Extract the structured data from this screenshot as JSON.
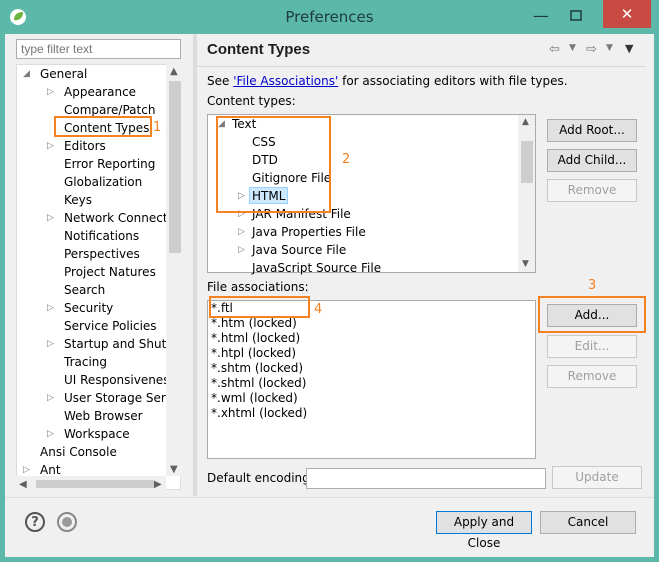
{
  "window": {
    "title": "Preferences",
    "minimize": "—",
    "close": "✕"
  },
  "filter": {
    "placeholder": "type filter text"
  },
  "tree": {
    "items": [
      {
        "label": "General",
        "twisty": "◢",
        "level": 0
      },
      {
        "label": "Appearance",
        "twisty": "▷",
        "level": 1
      },
      {
        "label": "Compare/Patch",
        "twisty": "",
        "level": 1
      },
      {
        "label": "Content Types",
        "twisty": "",
        "level": 1
      },
      {
        "label": "Editors",
        "twisty": "▷",
        "level": 1
      },
      {
        "label": "Error Reporting",
        "twisty": "",
        "level": 1
      },
      {
        "label": "Globalization",
        "twisty": "",
        "level": 1
      },
      {
        "label": "Keys",
        "twisty": "",
        "level": 1
      },
      {
        "label": "Network Connection",
        "twisty": "▷",
        "level": 1
      },
      {
        "label": "Notifications",
        "twisty": "",
        "level": 1
      },
      {
        "label": "Perspectives",
        "twisty": "",
        "level": 1
      },
      {
        "label": "Project Natures",
        "twisty": "",
        "level": 1
      },
      {
        "label": "Search",
        "twisty": "",
        "level": 1
      },
      {
        "label": "Security",
        "twisty": "▷",
        "level": 1
      },
      {
        "label": "Service Policies",
        "twisty": "",
        "level": 1
      },
      {
        "label": "Startup and Shutdown",
        "twisty": "▷",
        "level": 1
      },
      {
        "label": "Tracing",
        "twisty": "",
        "level": 1
      },
      {
        "label": "UI Responsiveness M",
        "twisty": "",
        "level": 1
      },
      {
        "label": "User Storage Service",
        "twisty": "▷",
        "level": 1
      },
      {
        "label": "Web Browser",
        "twisty": "",
        "level": 1
      },
      {
        "label": "Workspace",
        "twisty": "▷",
        "level": 1
      },
      {
        "label": "Ansi Console",
        "twisty": "",
        "level": 0
      },
      {
        "label": "Ant",
        "twisty": "▷",
        "level": 0
      }
    ]
  },
  "panel": {
    "title": "Content Types",
    "see_prefix": "See ",
    "see_link": "'File Associations'",
    "see_suffix": " for associating editors with file types.",
    "content_types_label": "Content types:",
    "file_assoc_label": "File associations:",
    "default_encoding_label": "Default encoding:",
    "default_encoding_value": ""
  },
  "content_types": [
    {
      "label": "Text",
      "twisty": "◢",
      "level": 0
    },
    {
      "label": "CSS",
      "twisty": "",
      "level": 1
    },
    {
      "label": "DTD",
      "twisty": "",
      "level": 1
    },
    {
      "label": "Gitignore File",
      "twisty": "",
      "level": 1
    },
    {
      "label": "HTML",
      "twisty": "▷",
      "level": 1,
      "selected": true
    },
    {
      "label": "JAR Manifest File",
      "twisty": "▷",
      "level": 1
    },
    {
      "label": "Java Properties File",
      "twisty": "▷",
      "level": 1
    },
    {
      "label": "Java Source File",
      "twisty": "▷",
      "level": 1
    },
    {
      "label": "JavaScript Source File",
      "twisty": "",
      "level": 1
    }
  ],
  "file_associations": [
    "*.ftl",
    "*.htm (locked)",
    "*.html (locked)",
    "*.htpl (locked)",
    "*.shtm (locked)",
    "*.shtml (locked)",
    "*.wml (locked)",
    "*.xhtml (locked)"
  ],
  "buttons": {
    "add_root": "Add Root...",
    "add_child": "Add Child...",
    "remove_ct": "Remove",
    "add": "Add...",
    "edit": "Edit...",
    "remove_fa": "Remove",
    "update": "Update",
    "apply_close": "Apply and Close",
    "cancel": "Cancel"
  },
  "annotations": [
    "1",
    "2",
    "3",
    "4"
  ],
  "colors": {
    "titlebar": "#5cb8a9",
    "annotation": "#f58220",
    "close": "#c74b42",
    "selection": "#cde8ff"
  }
}
